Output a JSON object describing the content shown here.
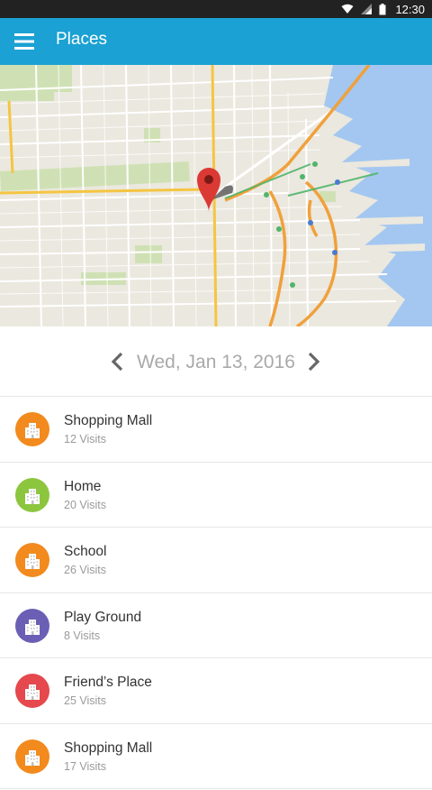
{
  "status_bar": {
    "time": "12:30",
    "icons": [
      "wifi-icon",
      "cell-signal-icon",
      "battery-icon"
    ]
  },
  "app_bar": {
    "title": "Places",
    "menu_icon": "menu-icon",
    "color": "#1ba1d3"
  },
  "map": {
    "pin_icon": "map-pin-icon",
    "pin_color": "#db3a34"
  },
  "date_nav": {
    "date": "Wed, Jan 13, 2016",
    "prev_icon": "chevron-left-icon",
    "next_icon": "chevron-right-icon"
  },
  "places": [
    {
      "name": "Shopping Mall",
      "visits": "12 Visits",
      "color": "#f28a1e",
      "icon": "building-icon"
    },
    {
      "name": "Home",
      "visits": "20 Visits",
      "color": "#8cc63f",
      "icon": "building-icon"
    },
    {
      "name": "School",
      "visits": "26 Visits",
      "color": "#f28a1e",
      "icon": "building-icon"
    },
    {
      "name": "Play Ground",
      "visits": "8 Visits",
      "color": "#6a5fb5",
      "icon": "building-icon"
    },
    {
      "name": "Friend’s Place",
      "visits": "25 Visits",
      "color": "#e5484d",
      "icon": "building-icon"
    },
    {
      "name": "Shopping Mall",
      "visits": "17 Visits",
      "color": "#f28a1e",
      "icon": "building-icon"
    }
  ]
}
